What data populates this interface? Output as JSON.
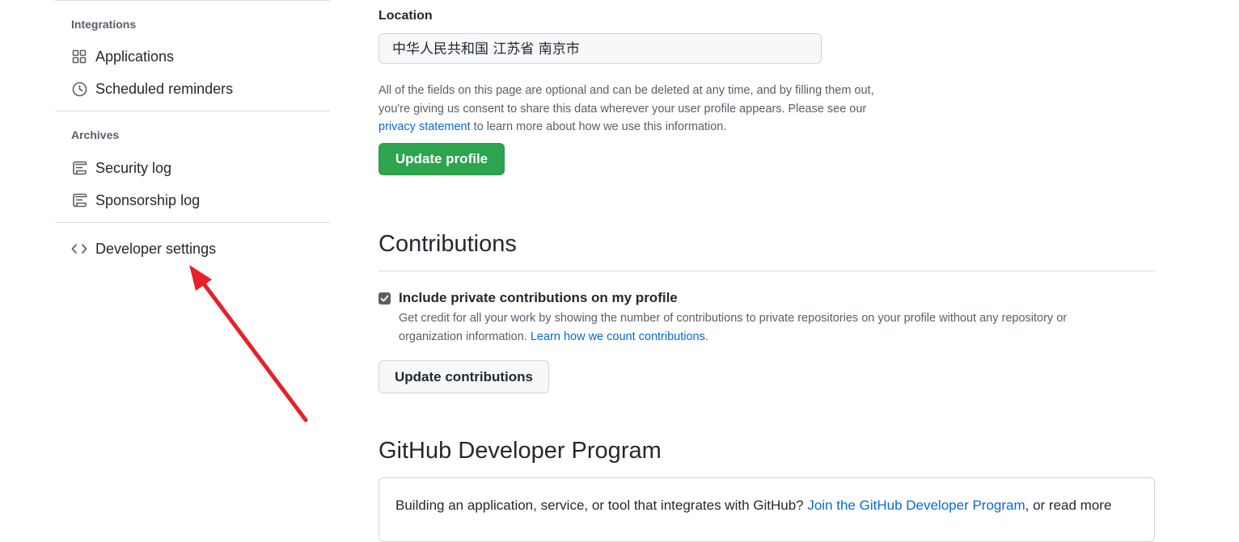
{
  "sidebar": {
    "sections": [
      {
        "heading": "Integrations",
        "items": [
          {
            "label": "Applications",
            "icon": "apps-grid-icon"
          },
          {
            "label": "Scheduled reminders",
            "icon": "clock-icon"
          }
        ]
      },
      {
        "heading": "Archives",
        "items": [
          {
            "label": "Security log",
            "icon": "log-icon"
          },
          {
            "label": "Sponsorship log",
            "icon": "log-icon"
          }
        ]
      }
    ],
    "developer_settings": {
      "label": "Developer settings",
      "icon": "code-icon"
    }
  },
  "profile": {
    "location_label": "Location",
    "location_value": "中华人民共和国 江苏省 南京市",
    "note_before": "All of the fields on this page are optional and can be deleted at any time, and by filling them out, you're giving us consent to share this data wherever your user profile appears. Please see our ",
    "note_link": "privacy statement",
    "note_after": " to learn more about how we use this information.",
    "update_button": "Update profile"
  },
  "contributions": {
    "heading": "Contributions",
    "checkbox_label": "Include private contributions on my profile",
    "checkbox_checked": true,
    "note": "Get credit for all your work by showing the number of contributions to private repositories on your profile without any repository or organization information. ",
    "note_link": "Learn how we count contributions",
    "note_end": ".",
    "update_button": "Update contributions"
  },
  "developer_program": {
    "heading": "GitHub Developer Program",
    "text_before": "Building an application, service, or tool that integrates with GitHub? ",
    "link": "Join the GitHub Developer Program",
    "text_after": ", or read more"
  },
  "colors": {
    "primary_button": "#2da44e",
    "link": "#0969da",
    "arrow": "#e8202a"
  }
}
